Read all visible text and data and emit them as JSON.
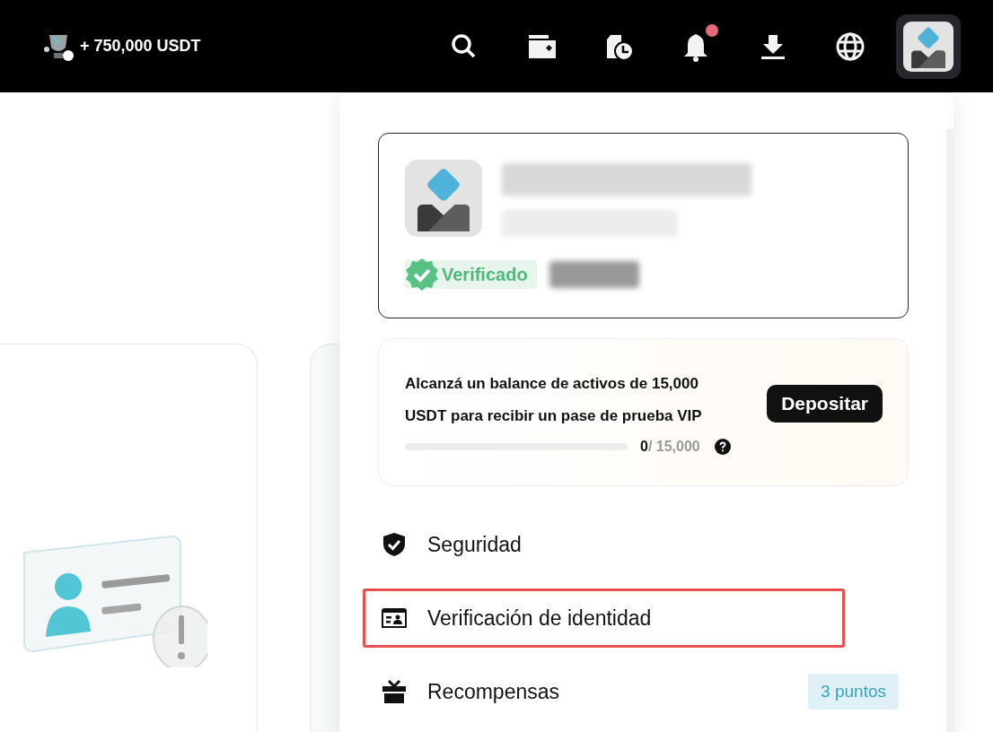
{
  "header": {
    "reward": "+ 750,000 USDT",
    "notification_unread": true
  },
  "profile": {
    "verified_label": "Verificado"
  },
  "promo": {
    "text": "Alcanzá un balance de activos de 15,000 USDT para recibir un pase de prueba VIP",
    "button": "Depositar",
    "progress": {
      "level": 0,
      "current": "0",
      "target": "/ 15,000"
    }
  },
  "menu": [
    {
      "kind": "security",
      "label": "Seguridad",
      "highlighted": false
    },
    {
      "kind": "identity",
      "label": "Verificación de identidad",
      "highlighted": true
    },
    {
      "kind": "rewards",
      "label": "Recompensas",
      "highlighted": false,
      "badge": "3 puntos"
    }
  ]
}
